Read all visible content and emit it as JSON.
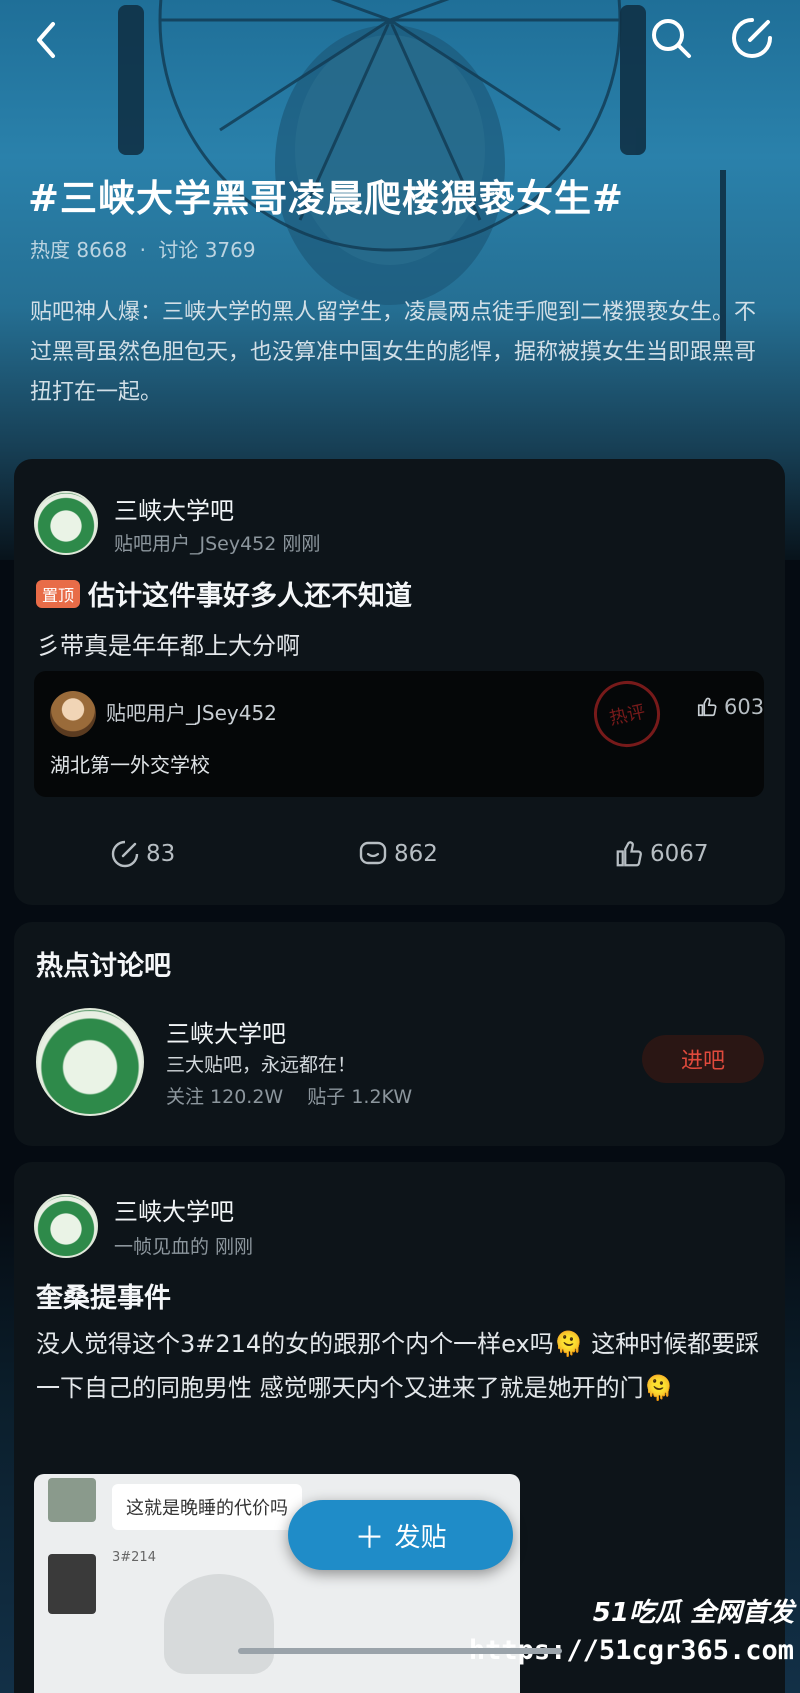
{
  "topic": {
    "title": "#三峡大学黑哥凌晨爬楼猥亵女生#",
    "heat": "热度 8668",
    "separator": "·",
    "discussions": "讨论 3769",
    "description": "贴吧神人爆：三峡大学的黑人留学生，凌晨两点徒手爬到二楼猥亵女生。不过黑哥虽然色胆包天，也没算准中国女生的彪悍，据称被摸女生当即跟黑哥扭打在一起。"
  },
  "post1": {
    "forum": "三峡大学吧",
    "author_time": "贴吧用户_JSey452 刚刚",
    "badge": "置顶",
    "title": "估计这件事好多人还不知道",
    "body": "彡带真是年年都上大分啊",
    "quote": {
      "user": "贴吧用户_JSey452",
      "text": "湖北第一外交学校",
      "stamp": "热评",
      "likes": "603"
    },
    "actions": {
      "share": "83",
      "comments": "862",
      "likes": "6067"
    }
  },
  "hot_section": {
    "heading": "热点讨论吧",
    "forum": "三峡大学吧",
    "slogan": "三大贴吧，永远都在！",
    "followers": "关注 120.2W",
    "posts": "贴子 1.2KW",
    "join_label": "进吧"
  },
  "post2": {
    "forum": "三峡大学吧",
    "author_time": "一帧见血的 刚刚",
    "title": "奎桑提事件",
    "body": "没人觉得这个3#214的女的跟那个内个一样ex吗🫠 这种时候都要踩一下自己的同胞男性 感觉哪天内个又进来了就是她开的门🫠",
    "image_caption": "这就是晚睡的代价吗",
    "image_tag": "3#214"
  },
  "fab": {
    "icon": "plus-icon",
    "label": "发贴"
  },
  "watermark": {
    "brand": "51吃瓜 全网首发",
    "url": "https://51cgr365.com"
  },
  "colors": {
    "accent": "#1f8cc8",
    "join": "#e04a3c",
    "badge": "#e86c48",
    "card": "#0d1419"
  }
}
